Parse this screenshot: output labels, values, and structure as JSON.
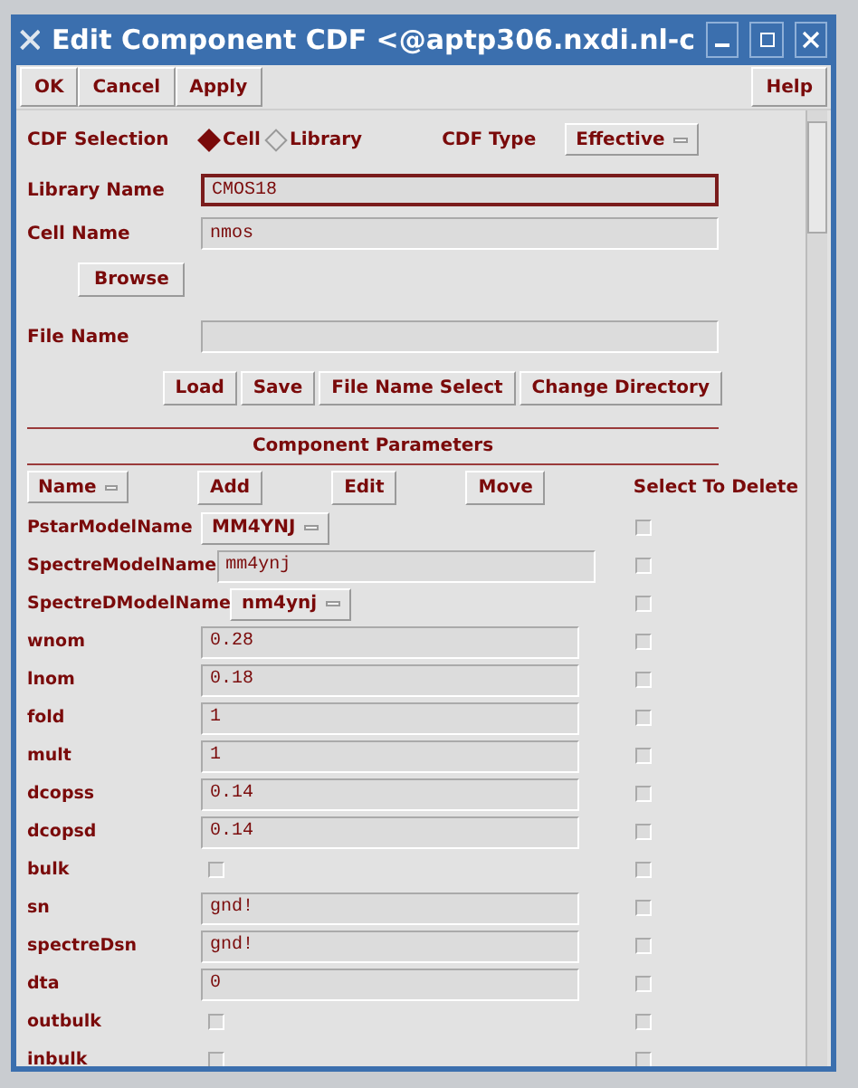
{
  "window": {
    "title": "Edit Component CDF  <@aptp306.nxdi.nl-c"
  },
  "toolbar": {
    "left": [
      "OK",
      "Cancel",
      "Apply"
    ],
    "right": [
      "Help"
    ]
  },
  "cdf_selection": {
    "label": "CDF Selection",
    "options": [
      {
        "label": "Cell",
        "selected": true
      },
      {
        "label": "Library",
        "selected": false
      }
    ]
  },
  "cdf_type": {
    "label": "CDF Type",
    "value": "Effective"
  },
  "library_name": {
    "label": "Library Name",
    "value": "CMOS18",
    "focused": true
  },
  "cell_name": {
    "label": "Cell Name",
    "value": "nmos",
    "focused": false
  },
  "browse_button": "Browse",
  "file_name": {
    "label": "File Name",
    "focused": false
  },
  "file_buttons": [
    "Load",
    "Save",
    "File Name Select",
    "Change Directory"
  ],
  "section_title": "Component Parameters",
  "param_controls": {
    "sort": "Name",
    "buttons": [
      "Add",
      "Edit",
      "Move"
    ],
    "delete_header": "Select To Delete"
  },
  "parameters": [
    {
      "name": "PstarModelName",
      "kind": "dropdown",
      "value": "MM4YNJ",
      "delete_checked": false
    },
    {
      "name": "SpectreModelName",
      "kind": "field",
      "value": "mm4ynj",
      "delete_checked": false
    },
    {
      "name": "SpectreDModelName",
      "kind": "dropdown",
      "value": "nm4ynj",
      "delete_checked": false
    },
    {
      "name": "wnom",
      "kind": "field",
      "value": "0.28",
      "delete_checked": false
    },
    {
      "name": "lnom",
      "kind": "field",
      "value": "0.18",
      "delete_checked": false
    },
    {
      "name": "fold",
      "kind": "field",
      "value": "1",
      "delete_checked": false
    },
    {
      "name": "mult",
      "kind": "field",
      "value": "1",
      "delete_checked": false
    },
    {
      "name": "dcopss",
      "kind": "field",
      "value": "0.14",
      "delete_checked": false
    },
    {
      "name": "dcopsd",
      "kind": "field",
      "value": "0.14",
      "delete_checked": false
    },
    {
      "name": "bulk",
      "kind": "checkbox",
      "checked": false,
      "delete_checked": false
    },
    {
      "name": "sn",
      "kind": "field",
      "value": "gnd!",
      "delete_checked": false
    },
    {
      "name": "spectreDsn",
      "kind": "field",
      "value": "gnd!",
      "delete_checked": false
    },
    {
      "name": "dta",
      "kind": "field",
      "value": "0",
      "delete_checked": false
    },
    {
      "name": "outbulk",
      "kind": "checkbox",
      "checked": false,
      "delete_checked": false
    },
    {
      "name": "inbulk",
      "kind": "checkbox",
      "checked": false,
      "delete_checked": false
    }
  ]
}
